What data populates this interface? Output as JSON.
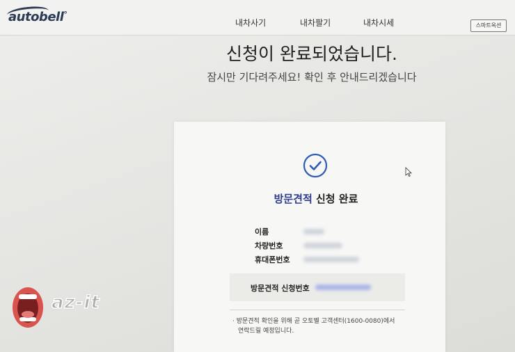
{
  "header": {
    "logo_text": "autobell",
    "logo_mark": "°",
    "nav": [
      "내차사기",
      "내차팔기",
      "내차시세"
    ],
    "smart_button": "스마트옥션"
  },
  "main": {
    "headline": "신청이 완료되었습니다.",
    "subline": "잠시만 기다려주세요! 확인 후 안내드리겠습니다"
  },
  "card": {
    "title_accent": "방문견적",
    "title_rest": " 신청 완료",
    "fields": [
      {
        "label": "이름"
      },
      {
        "label": "차량번호"
      },
      {
        "label": "휴대폰번호"
      }
    ],
    "request_label": "방문견적 신청번호",
    "notice_line1": "· 방문견적 확인을 위해 곧 오토벨 고객센터(1600-0080)에서",
    "notice_line2": "연락드릴 예정입니다."
  },
  "watermark": {
    "text": "az-it"
  },
  "colors": {
    "accent": "#2b3a8c",
    "check": "#2f5bb7",
    "mouth": "#d9534f"
  }
}
